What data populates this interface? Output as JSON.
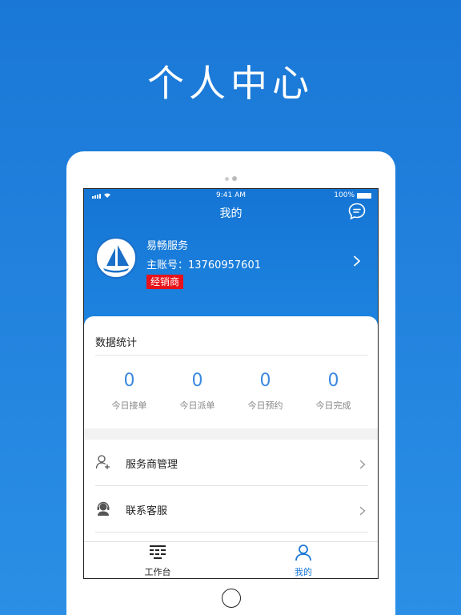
{
  "promo": {
    "title": "个人中心"
  },
  "status_bar": {
    "time": "9:41 AM",
    "battery": "100%"
  },
  "header": {
    "title": "我的",
    "message_icon": "chat-bubble-icon"
  },
  "profile": {
    "company_name": "易畅服务",
    "account_label": "主账号：13760957601",
    "role_badge": "经销商"
  },
  "stats": {
    "title": "数据统计",
    "items": [
      {
        "value": "0",
        "label": "今日接单"
      },
      {
        "value": "0",
        "label": "今日派单"
      },
      {
        "value": "0",
        "label": "今日预约"
      },
      {
        "value": "0",
        "label": "今日完成"
      }
    ]
  },
  "menu": [
    {
      "label": "服务商管理",
      "icon": "user-add-icon"
    },
    {
      "label": "联系客服",
      "icon": "headset-icon"
    }
  ],
  "tabs": [
    {
      "label": "工作台",
      "icon": "grid-icon",
      "active": false
    },
    {
      "label": "我的",
      "icon": "user-icon",
      "active": true
    }
  ],
  "colors": {
    "accent": "#1a77d6",
    "badge": "#e8121a",
    "stat_value": "#3b8ae0"
  }
}
